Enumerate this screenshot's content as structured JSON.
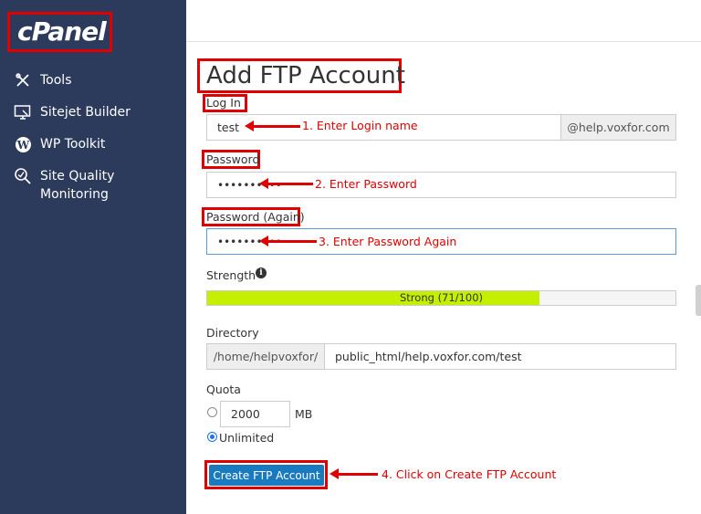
{
  "brand": {
    "logo_text": "cPanel"
  },
  "sidebar": {
    "items": [
      {
        "label": "Tools",
        "icon": "tools-icon"
      },
      {
        "label": "Sitejet Builder",
        "icon": "sitejet-icon"
      },
      {
        "label": "WP Toolkit",
        "icon": "wordpress-icon"
      },
      {
        "label": "Site Quality\nMonitoring",
        "icon": "site-quality-icon"
      }
    ]
  },
  "form": {
    "title": "Add FTP Account",
    "login": {
      "label": "Log In",
      "value": "test",
      "domain_addon": "@help.voxfor.com"
    },
    "password": {
      "label": "Password",
      "value": "••••••••••"
    },
    "password_again": {
      "label": "Password (Again)",
      "value": "••••••••••"
    },
    "strength": {
      "label": "Strength",
      "text": "Strong (71/100)",
      "score": 71,
      "fill_fraction": 0.71
    },
    "directory": {
      "label": "Directory",
      "prefix": "/home/helpvoxfor/",
      "value": "public_html/help.voxfor.com/test"
    },
    "quota": {
      "label": "Quota",
      "value": "2000",
      "unit": "MB",
      "unlimited_label": "Unlimited",
      "selected": "unlimited"
    },
    "submit_label": "Create FTP Account"
  },
  "annotations": {
    "step1": "1. Enter Login name",
    "step2": "2. Enter Password",
    "step3": "3. Enter Password Again",
    "step4": "4. Click on Create FTP Account"
  },
  "colors": {
    "sidebar_bg": "#2c3a5c",
    "annotation_red": "#e00000",
    "strength_fill": "#c4f000",
    "button_bg": "#1a7abf"
  }
}
